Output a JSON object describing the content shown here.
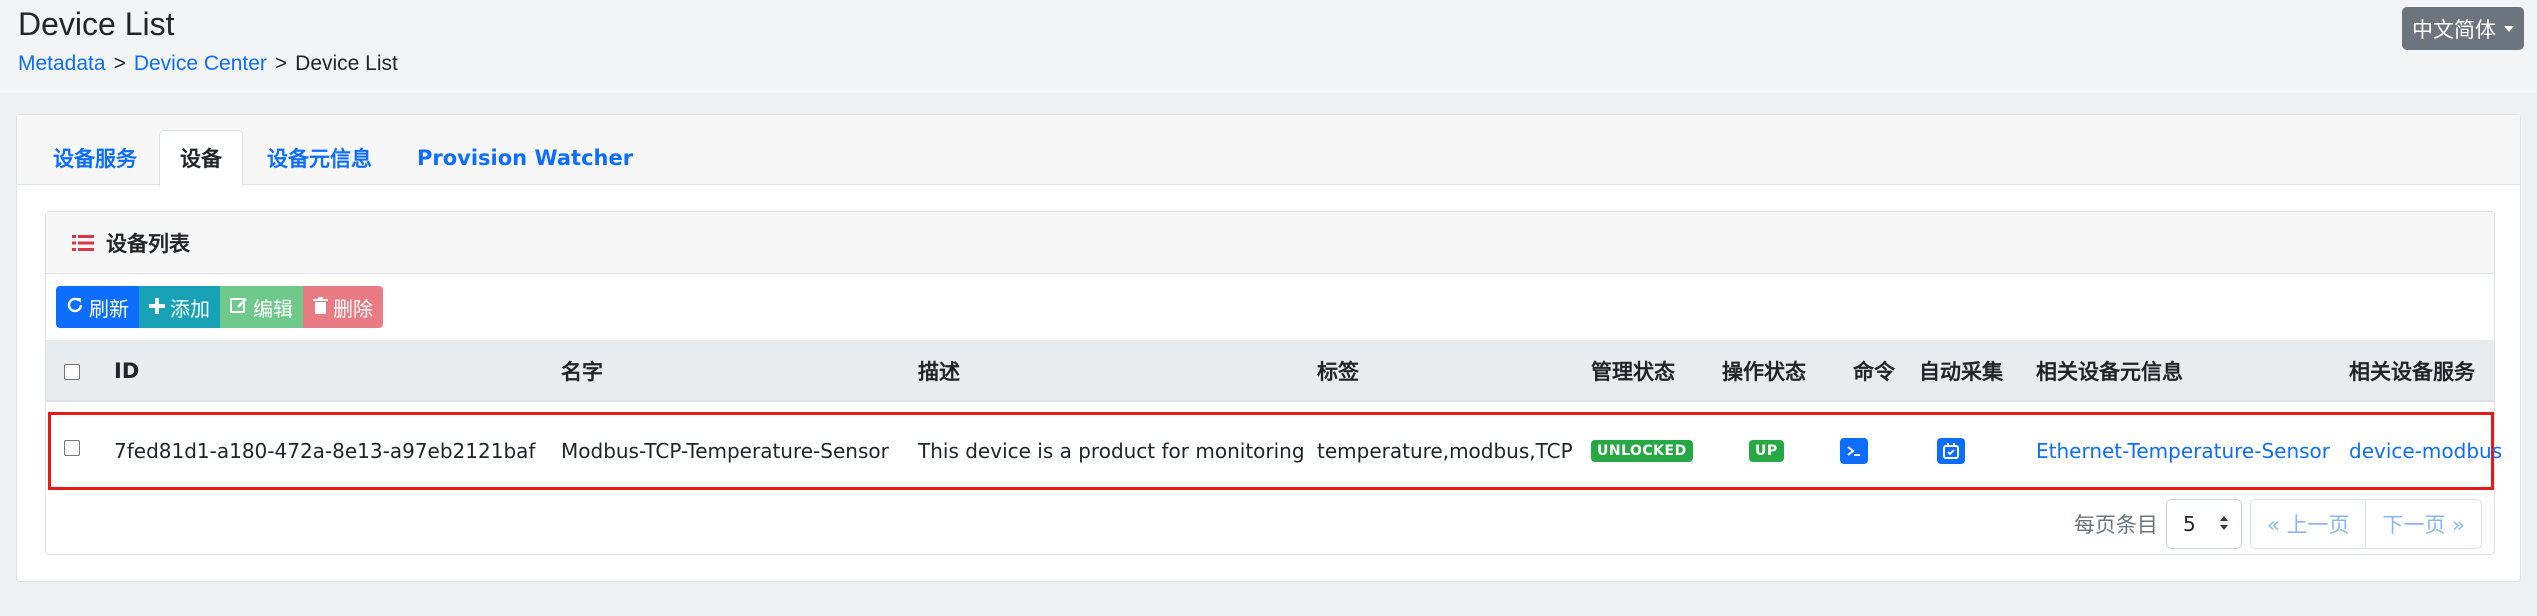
{
  "header": {
    "title": "Device List",
    "breadcrumb": [
      "Metadata",
      "Device Center",
      "Device List"
    ],
    "breadcrumb_sep": ">",
    "language": "中文简体"
  },
  "tabs": [
    {
      "label": "设备服务",
      "active": false
    },
    {
      "label": "设备",
      "active": true
    },
    {
      "label": "设备元信息",
      "active": false
    },
    {
      "label": "Provision Watcher",
      "active": false
    }
  ],
  "card": {
    "title": "设备列表",
    "toolbar": {
      "refresh": "刷新",
      "add": "添加",
      "edit": "编辑",
      "delete": "删除"
    }
  },
  "table": {
    "columns": [
      "ID",
      "名字",
      "描述",
      "标签",
      "管理状态",
      "操作状态",
      "命令",
      "自动采集",
      "相关设备元信息",
      "相关设备服务"
    ],
    "rows": [
      {
        "id": "7fed81d1-a180-472a-8e13-a97eb2121baf",
        "name": "Modbus-TCP-Temperature-Sensor",
        "description": "This device is a product for monitoring",
        "labels": "temperature,modbus,TCP",
        "admin_state": "UNLOCKED",
        "op_state": "UP",
        "profile": "Ethernet-Temperature-Sensor",
        "service": "device-modbus"
      }
    ]
  },
  "pagination": {
    "per_page_label": "每页条目",
    "per_page_value": "5",
    "prev": "« 上一页",
    "next": "下一页 »"
  },
  "colors": {
    "primary": "#0d6efd",
    "info": "#17a2b8",
    "success": "#28a745",
    "danger": "#e97b85",
    "highlight": "#e31b1b"
  }
}
